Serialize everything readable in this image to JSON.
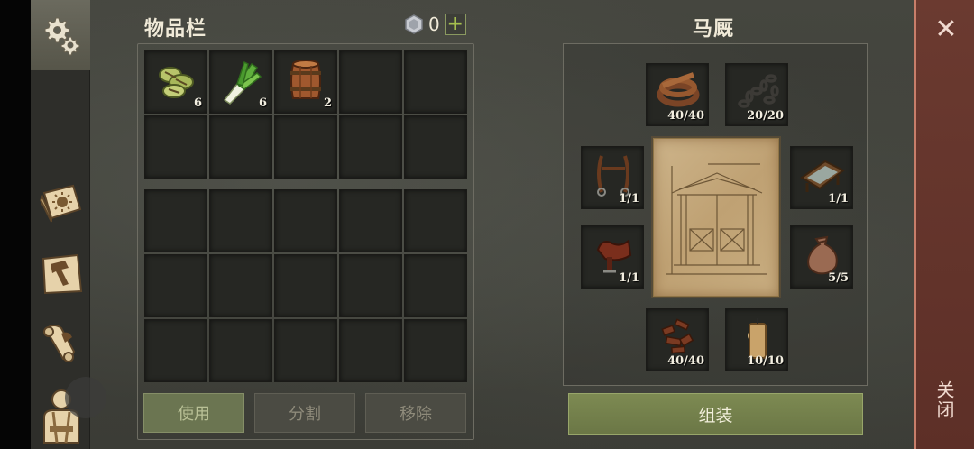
{
  "inventory": {
    "title": "物品栏",
    "currency": {
      "icon": "gem-icon",
      "amount": "0",
      "add_label": "+"
    },
    "top_grid": [
      {
        "icon": "grilled-slices-icon",
        "count": "6"
      },
      {
        "icon": "leek-icon",
        "count": "6"
      },
      {
        "icon": "barrel-icon",
        "count": "2"
      },
      {
        "icon": "",
        "count": ""
      },
      {
        "icon": "",
        "count": ""
      },
      {
        "icon": "",
        "count": ""
      },
      {
        "icon": "",
        "count": ""
      },
      {
        "icon": "",
        "count": ""
      },
      {
        "icon": "",
        "count": ""
      },
      {
        "icon": "",
        "count": ""
      }
    ],
    "buttons": {
      "use": "使用",
      "split": "分割",
      "remove": "移除"
    }
  },
  "stable": {
    "title": "马厩",
    "parts": [
      {
        "name": "leather-strap",
        "icon": "leather-strap-icon",
        "count": "40/40"
      },
      {
        "name": "chain",
        "icon": "chain-icon",
        "count": "20/20"
      },
      {
        "name": "bridle",
        "icon": "bridle-icon",
        "count": "1/1"
      },
      {
        "name": "trough",
        "icon": "trough-icon",
        "count": "1/1"
      },
      {
        "name": "saddle",
        "icon": "saddle-icon",
        "count": "1/1"
      },
      {
        "name": "sack",
        "icon": "sack-icon",
        "count": "5/5"
      },
      {
        "name": "leather-scraps",
        "icon": "leather-scraps-icon",
        "count": "40/40"
      },
      {
        "name": "candle",
        "icon": "candle-icon",
        "count": "10/10"
      }
    ],
    "assemble_label": "组装"
  },
  "close": {
    "label": "关闭",
    "icon": "close-icon"
  },
  "sidebar": {
    "items": [
      {
        "icon": "settings-gears-icon"
      },
      {
        "icon": "sun-book-icon"
      },
      {
        "icon": "crafting-hammer-icon"
      },
      {
        "icon": "quest-scroll-icon"
      },
      {
        "icon": "character-icon"
      }
    ]
  },
  "colors": {
    "accent_green": "#7d8a52",
    "close_red": "#6b3a30",
    "slot_bg": "#262723"
  }
}
